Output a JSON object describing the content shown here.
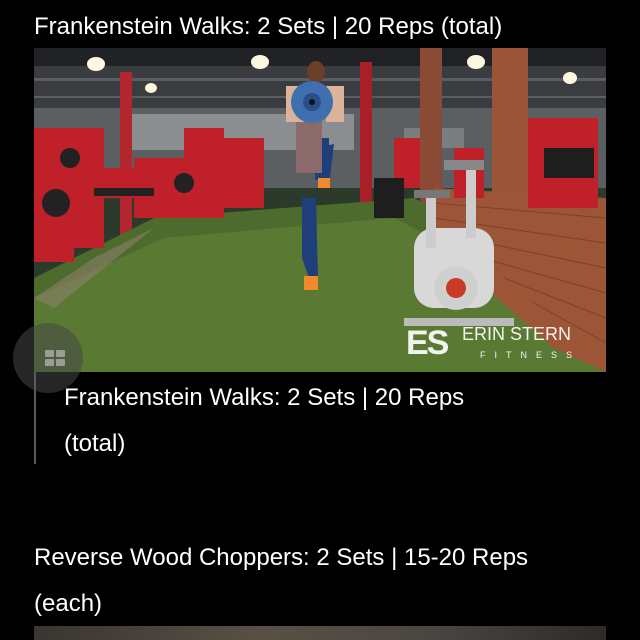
{
  "exercise1": {
    "title": "Frankenstein Walks: 2 Sets | 20 Reps (total)",
    "caption_line1": "Frankenstein Walks: 2 Sets | 20 Reps",
    "caption_line2": "(total)",
    "video": {
      "logo_mark": "ES",
      "logo_name": "ERIN STERN",
      "logo_sub": "FITNESS"
    }
  },
  "exercise2": {
    "title_line1": "Reverse Wood Choppers: 2 Sets | 15-20 Reps",
    "title_line2": "(each)"
  },
  "overlay": {
    "icon": "grid-icon"
  },
  "colors": {
    "background": "#000000",
    "text": "#ffffff",
    "caption_rule": "#5a5a5a",
    "gym_red": "#c0202a",
    "turf_green": "#4e6b2e"
  }
}
